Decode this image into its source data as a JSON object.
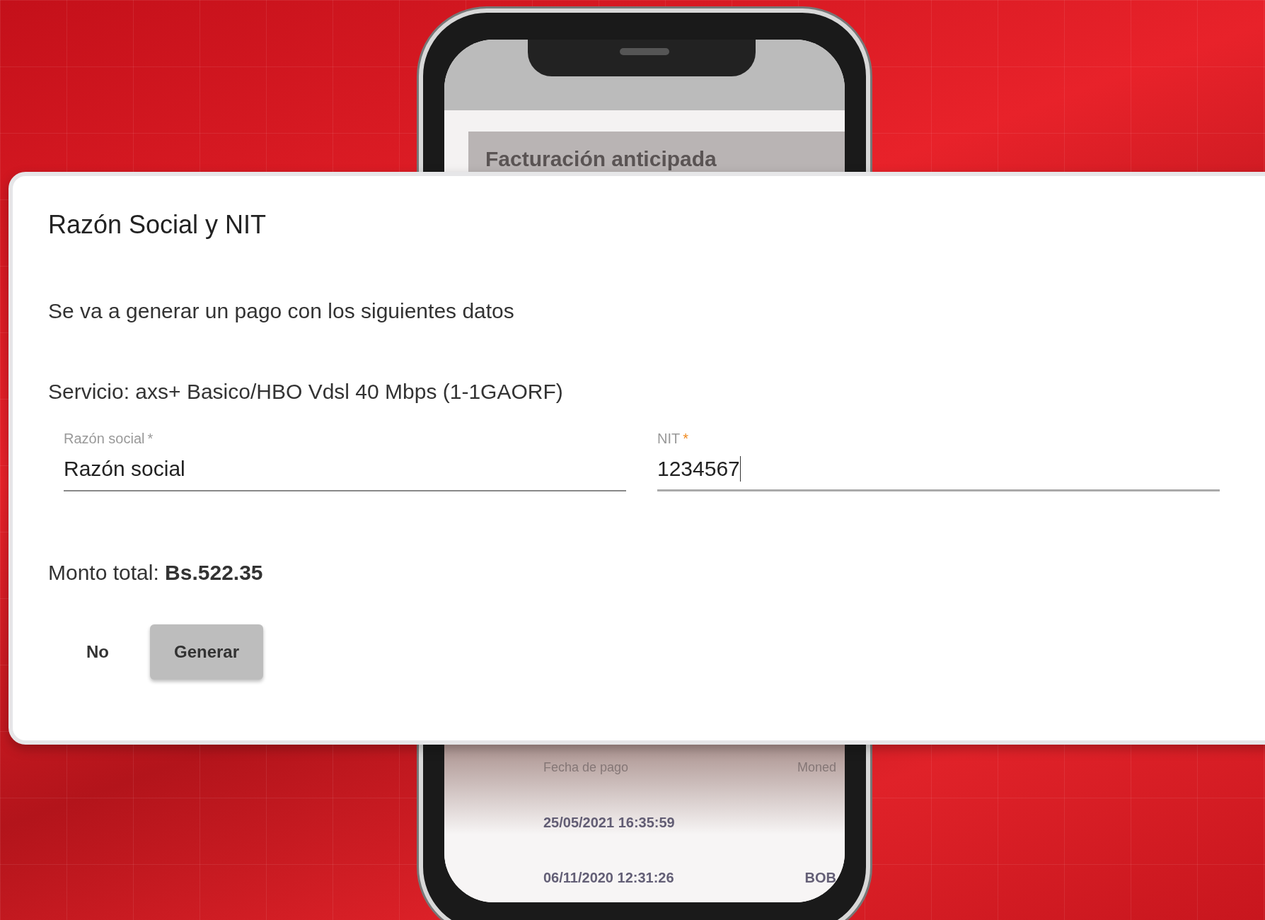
{
  "phone": {
    "card_title": "Facturación anticipada",
    "table_headers": [
      "Fecha de pago",
      "Moned"
    ],
    "rows": [
      [
        "25/05/2021 16:35:59"
      ],
      [
        "06/11/2020 12:31:26",
        "BOB"
      ]
    ]
  },
  "dialog": {
    "title": "Razón Social y NIT",
    "message": "Se va a generar un pago con los siguientes datos",
    "service": "Servicio: axs+ Basico/HBO Vdsl 40 Mbps (1-1GAORF)",
    "fields": [
      {
        "label": "Razón social",
        "required_mark": "*",
        "value": "Razón social",
        "focused": false
      },
      {
        "label": "NIT",
        "required_mark": "*",
        "value": "1234567",
        "focused": true
      }
    ],
    "total": "Monto total: **Bs.522.35**",
    "buttons": [
      {
        "label": "No",
        "kind": "text"
      },
      {
        "label": "Generar",
        "kind": "raised"
      }
    ]
  }
}
